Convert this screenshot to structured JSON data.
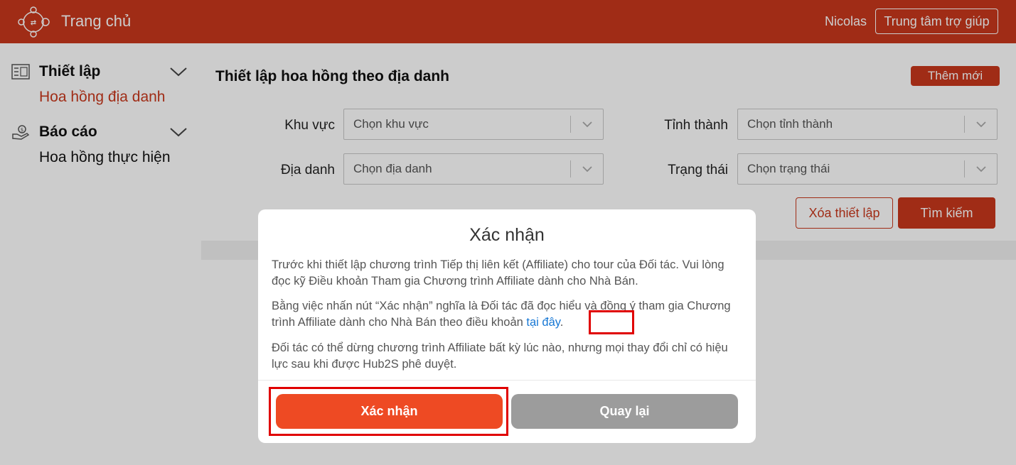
{
  "header": {
    "home_label": "Trang chủ",
    "user_name": "Nicolas",
    "help_label": "Trung tâm trợ giúp"
  },
  "sidebar": {
    "groups": [
      {
        "label": "Thiết lập",
        "icon": "settings-board-icon",
        "items": [
          {
            "label": "Hoa hồng địa danh",
            "active": true
          }
        ]
      },
      {
        "label": "Báo cáo",
        "icon": "money-hand-icon",
        "items": [
          {
            "label": "Hoa hồng thực hiện",
            "active": false
          }
        ]
      }
    ]
  },
  "main": {
    "title": "Thiết lập hoa hồng theo địa danh",
    "add_label": "Thêm mới",
    "filters": {
      "region": {
        "label": "Khu vực",
        "placeholder": "Chọn khu vực"
      },
      "province": {
        "label": "Tỉnh thành",
        "placeholder": "Chọn tỉnh thành"
      },
      "place": {
        "label": "Địa danh",
        "placeholder": "Chọn địa danh"
      },
      "status": {
        "label": "Trạng thái",
        "placeholder": "Chọn trạng thái"
      }
    },
    "clear_label": "Xóa thiết lập",
    "search_label": "Tìm kiếm"
  },
  "modal": {
    "title": "Xác nhận",
    "p1": "Trước khi thiết lập chương trình Tiếp thị liên kết (Affiliate) cho tour của Đối tác. Vui lòng đọc kỹ Điều khoản Tham gia Chương trình Affiliate dành cho Nhà Bán.",
    "p2_text": "Bằng việc nhấn nút “Xác nhận” nghĩa là Đối tác đã đọc hiểu và đồng ý tham gia Chương trình Affiliate dành cho Nhà Bán theo điều khoản ",
    "p2_link": "tại đây",
    "p2_end": ".",
    "p3": "Đối tác có thể dừng chương trình Affiliate bất kỳ lúc nào, nhưng mọi thay đổi chỉ có hiệu lực sau khi được Hub2S phê duyệt.",
    "confirm_label": "Xác nhận",
    "back_label": "Quay lại"
  },
  "colors": {
    "brand": "#c8381c",
    "confirm": "#ee4a23",
    "back": "#9c9c9c",
    "link": "#1677d4",
    "highlight": "#e00000"
  }
}
